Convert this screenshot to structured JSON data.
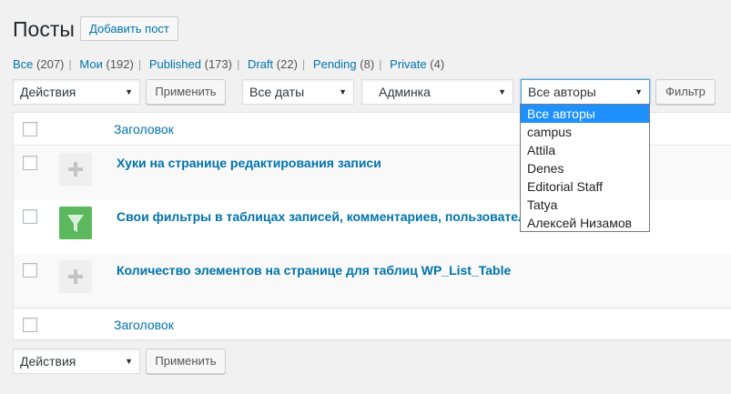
{
  "header": {
    "title": "Посты",
    "add_new_label": "Добавить пост"
  },
  "views": [
    {
      "label": "Все",
      "count": "(207)"
    },
    {
      "label": "Мои",
      "count": "(192)"
    },
    {
      "label": "Published",
      "count": "(173)"
    },
    {
      "label": "Draft",
      "count": "(22)"
    },
    {
      "label": "Pending",
      "count": "(8)"
    },
    {
      "label": "Private",
      "count": "(4)"
    }
  ],
  "separator": "|",
  "filters": {
    "bulk_actions": "Действия",
    "apply_label": "Применить",
    "dates": "Все даты",
    "category": "Админка",
    "authors": "Все авторы",
    "filter_label": "Фильтр"
  },
  "author_options": [
    "Все авторы",
    "campus",
    "Attila",
    "Denes",
    "Editorial Staff",
    "Tatya",
    "Алексей Низамов"
  ],
  "table": {
    "column_title": "Заголовок",
    "rows": [
      {
        "title": "Хуки на странице редактирования записи",
        "thumb": "plus-icon"
      },
      {
        "title": "Свои фильтры в таблицах записей, комментариев, пользователей,",
        "thumb": "filter-icon"
      },
      {
        "title": "Количество элементов на странице для таблиц WP_List_Table",
        "thumb": "plus-icon"
      }
    ],
    "footer_title": "Заголовок"
  },
  "bottom": {
    "bulk_actions": "Действия",
    "apply_label": "Применить"
  },
  "colors": {
    "link": "#0073aa",
    "selected_option": "#1e90ff",
    "filter_icon_bg": "#5cb85c"
  }
}
